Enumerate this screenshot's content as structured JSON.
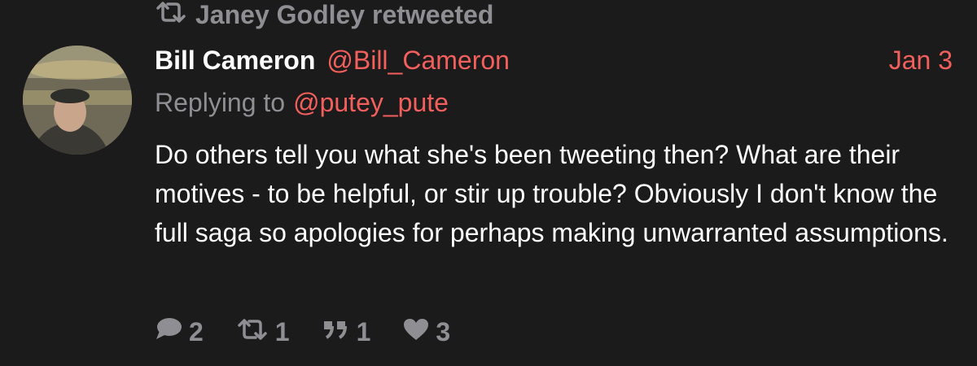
{
  "retweet_banner": {
    "icon": "retweet-icon",
    "text": "Janey Godley retweeted"
  },
  "tweet": {
    "avatar": "profile-photo",
    "author_name": "Bill Cameron",
    "author_handle": "@Bill_Cameron",
    "date": "Jan 3",
    "reply_prefix": "Replying to",
    "reply_handle": "@putey_pute",
    "body": "Do others tell you what she's been tweeting then? What are their motives - to be helpful, or stir up trouble? Obviously I don't know the full saga so apologies for perhaps making unwarranted assumptions."
  },
  "actions": {
    "reply_count": "2",
    "retweet_count": "1",
    "quote_count": "1",
    "like_count": "3"
  },
  "colors": {
    "background": "#1c1b1c",
    "accent": "#f25f5c",
    "muted": "#8e8e93",
    "text": "#ffffff"
  }
}
